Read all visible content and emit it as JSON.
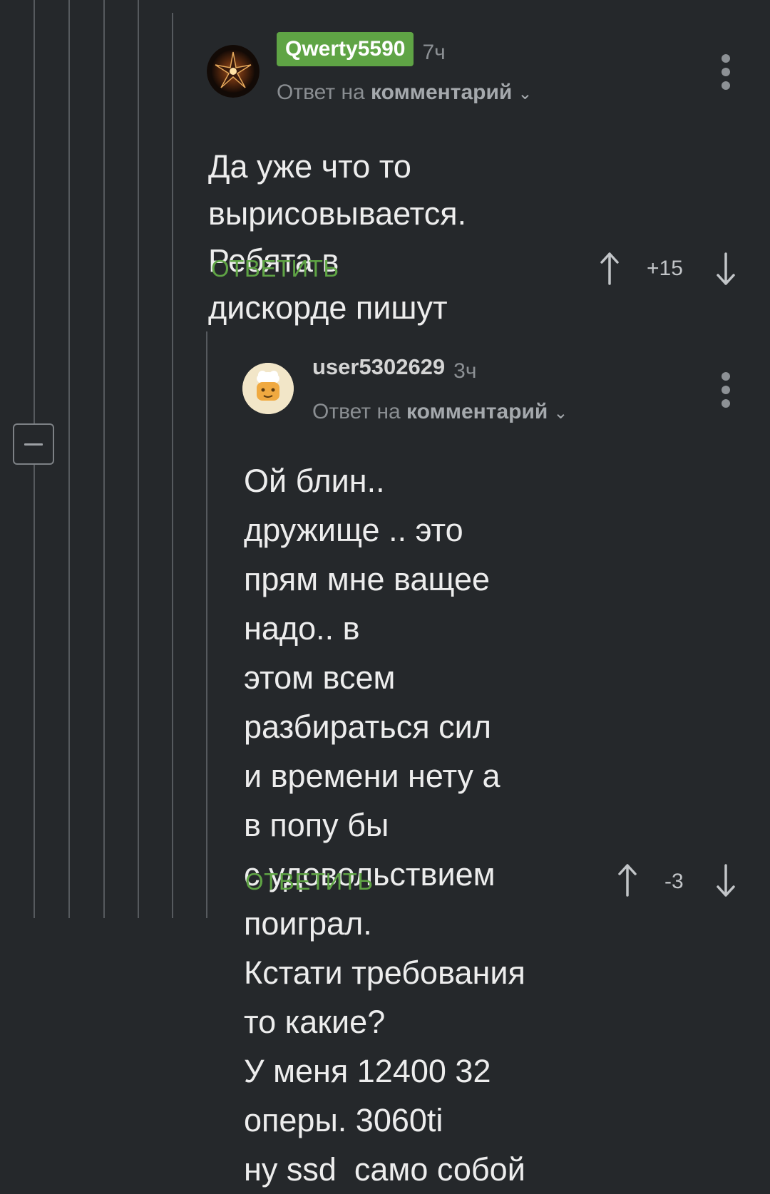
{
  "comments": [
    {
      "username": "Qwerty5590",
      "time": "7ч",
      "reply_prefix": "Ответ на",
      "reply_target": "комментарий",
      "lines": [
        "Да уже что то вырисовывается.",
        "Ребята в дискорде пишут"
      ],
      "reply_label": "ОТВЕТИТЬ",
      "rating": "+15"
    },
    {
      "username": "user5302629",
      "time": "3ч",
      "reply_prefix": "Ответ на",
      "reply_target": "комментарий",
      "lines": [
        "Ой блин.. дружище .. это",
        "прям мне ващее надо.. в",
        "этом всем разбираться сил",
        "и времени нету а в попу бы",
        "с удовольствием поиграл.",
        "Кстати требования то какие?",
        "У меня 12400 32 оперы. 3060ti",
        "ну ssd  само собой"
      ],
      "reply_label": "ОТВЕТИТЬ",
      "rating": "-3"
    }
  ],
  "icons": {
    "vote_up": "arrow-up-icon",
    "vote_down": "arrow-down-icon",
    "more": "more-vertical-icon",
    "collapse": "minus-icon",
    "chevron": "chevron-down-icon"
  },
  "colors": {
    "background": "#25282b",
    "accent_green": "#5fa445",
    "thread_line": "#565a5e",
    "muted_text": "#8a8e92"
  }
}
